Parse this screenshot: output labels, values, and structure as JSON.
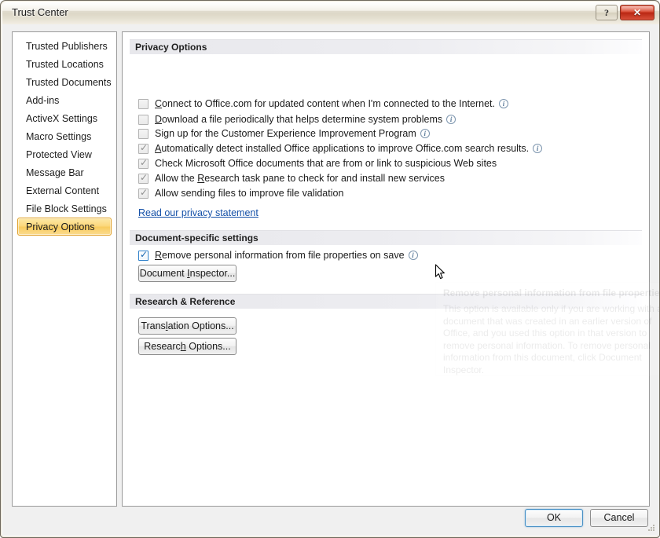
{
  "window": {
    "title": "Trust Center",
    "help_label": "?",
    "close_label": "✕"
  },
  "sidebar": {
    "items": [
      {
        "label": "Trusted Publishers",
        "selected": false
      },
      {
        "label": "Trusted Locations",
        "selected": false
      },
      {
        "label": "Trusted Documents",
        "selected": false
      },
      {
        "label": "Add-ins",
        "selected": false
      },
      {
        "label": "ActiveX Settings",
        "selected": false
      },
      {
        "label": "Macro Settings",
        "selected": false
      },
      {
        "label": "Protected View",
        "selected": false
      },
      {
        "label": "Message Bar",
        "selected": false
      },
      {
        "label": "External Content",
        "selected": false
      },
      {
        "label": "File Block Settings",
        "selected": false
      },
      {
        "label": "Privacy Options",
        "selected": true
      }
    ]
  },
  "sections": {
    "privacy_options": {
      "heading": "Privacy Options",
      "checkboxes": [
        {
          "accel": "C",
          "rest": "onnect to Office.com for updated content when I'm connected to the Internet.",
          "checked": false,
          "info": true
        },
        {
          "accel": "D",
          "rest": "ownload a file periodically that helps determine system problems",
          "checked": false,
          "info": true
        },
        {
          "accel": "Sig",
          "rest": "n up for the Customer Experience Improvement Program",
          "checked": false,
          "info": true,
          "accel_prefix": "Si",
          "accel_char": "g"
        },
        {
          "accel": "A",
          "rest": "utomatically detect installed Office applications to improve Office.com search results.",
          "checked": true,
          "info": true
        },
        {
          "accel": "",
          "rest": "Check Microsoft Office documents that are from or link to suspicious Web sites",
          "checked": true,
          "info": false
        },
        {
          "accel": "",
          "rest": "Allow the Research task pane to check for and install new services",
          "checked": true,
          "info": false,
          "pre": "Allow the ",
          "mid": "R",
          "post": "esearch task pane to check for and install new services"
        },
        {
          "accel": "",
          "rest": "Allow sending files to improve file validation",
          "checked": true,
          "info": false
        }
      ],
      "link_label": "Read our privacy statement"
    },
    "document_specific": {
      "heading": "Document-specific settings",
      "checkbox": {
        "pre": "",
        "accel": "R",
        "rest": "emove personal information from file properties on save",
        "checked": true,
        "info": true
      },
      "button": {
        "pre": "Document ",
        "accel": "I",
        "post": "nspector..."
      }
    },
    "research_reference": {
      "heading": "Research & Reference",
      "buttons": [
        {
          "pre": "Trans",
          "accel": "l",
          "post": "ation Options..."
        },
        {
          "pre": "Researc",
          "accel": "h",
          "post": " Options..."
        }
      ]
    }
  },
  "tooltip": {
    "title": "Remove personal information from file properties on save",
    "body": "This option is available only if you are working with a document that was created in an earlier version of Office, and you used this option in that version to remove personal information. To remove personal information from this document, click Document Inspector."
  },
  "footer": {
    "ok_label": "OK",
    "cancel_label": "Cancel"
  }
}
